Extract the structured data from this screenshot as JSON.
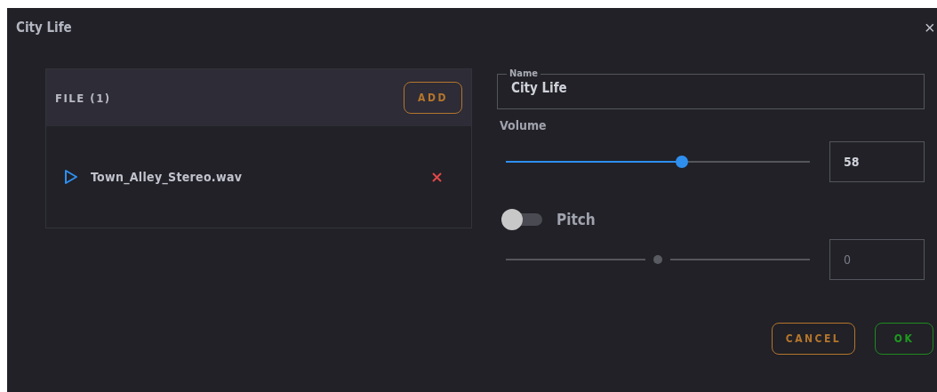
{
  "window": {
    "title": "City Life",
    "close": "×"
  },
  "files": {
    "title": "FILE (1)",
    "add": "ADD",
    "items": [
      {
        "name": "Town_Alley_Stereo.wav"
      }
    ]
  },
  "name_field": {
    "label": "Name",
    "value": "City Life"
  },
  "volume": {
    "label": "Volume",
    "level": 0.58,
    "value": "58"
  },
  "pitch": {
    "label": "Pitch",
    "on": false,
    "level": 0.5,
    "value": "0"
  },
  "buttons": [
    {
      "label": "CANCEL",
      "kind": "cancel"
    },
    {
      "label": "OK",
      "kind": "ok"
    }
  ]
}
